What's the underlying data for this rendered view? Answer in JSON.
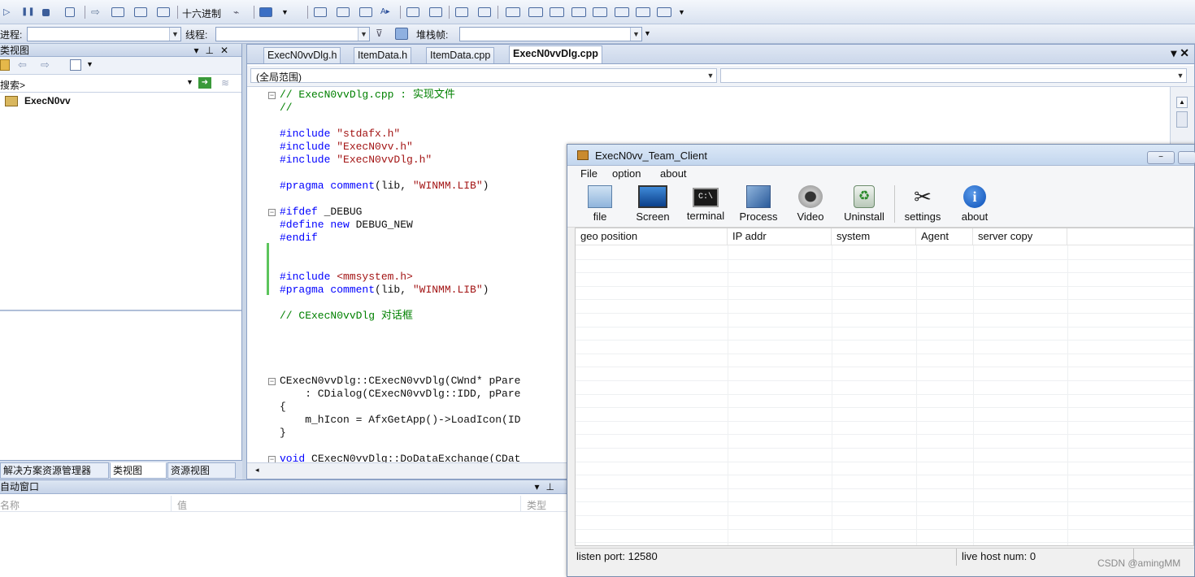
{
  "toolbar": {
    "hex_label": "十六进制",
    "process_label": "进程:",
    "thread_label": "线程:",
    "stackframe_label": "堆栈帧:"
  },
  "classview": {
    "title": "类视图",
    "search_placeholder": "搜索>",
    "tree_root": "ExecN0vv",
    "tabs": [
      "解决方案资源管理器",
      "类视图",
      "资源视图"
    ]
  },
  "editor": {
    "tabs": [
      "ExecN0vvDlg.h",
      "ItemData.h",
      "ItemData.cpp",
      "ExecN0vvDlg.cpp"
    ],
    "active_tab": "ExecN0vvDlg.cpp",
    "close_glyph": "▾ ✕",
    "scope": "(全局范围)",
    "code": {
      "l1": "// ExecN0vvDlg.cpp : 实现文件",
      "l2": "//",
      "l3a": "#include ",
      "l3b": "\"stdafx.h\"",
      "l4a": "#include ",
      "l4b": "\"ExecN0vv.h\"",
      "l5a": "#include ",
      "l5b": "\"ExecN0vvDlg.h\"",
      "l6a": "#pragma comment",
      "l6b": "(lib, ",
      "l6c": "\"WINMM.LIB\"",
      "l6d": ")",
      "l7a": "#ifdef",
      "l7b": " _DEBUG",
      "l8a": "#define",
      "l8b": " new",
      "l8c": " DEBUG_NEW",
      "l9": "#endif",
      "l10a": "#include ",
      "l10b": "<mmsystem.h>",
      "l11a": "#pragma comment",
      "l11b": "(lib, ",
      "l11c": "\"WINMM.LIB\"",
      "l11d": ")",
      "l12": "// CExecN0vvDlg 对话框",
      "l13": "CExecN0vvDlg::CExecN0vvDlg(CWnd* pPare",
      "l14": "    : CDialog(CExecN0vvDlg::IDD, pPare",
      "l15": "{",
      "l16": "    m_hIcon = AfxGetApp()->LoadIcon(ID",
      "l17": "}",
      "l18a": "void",
      "l18b": " CExecN0vvDlg::DoDataExchange(CDat"
    }
  },
  "autowin": {
    "title": "自动窗口",
    "col_name": "名称",
    "col_value": "值",
    "col_type": "类型"
  },
  "dialog": {
    "title": "ExecN0vv_Team_Client",
    "menu": [
      "File",
      "option",
      "about"
    ],
    "tools": [
      {
        "label": "file",
        "icon": "folder-icon"
      },
      {
        "label": "Screen",
        "icon": "monitor-icon"
      },
      {
        "label": "terminal",
        "icon": "terminal-icon"
      },
      {
        "label": "Process",
        "icon": "process-icon"
      },
      {
        "label": "Video",
        "icon": "webcam-icon"
      },
      {
        "label": "Uninstall",
        "icon": "recycle-icon"
      },
      {
        "label": "settings",
        "icon": "tools-icon"
      },
      {
        "label": "about",
        "icon": "info-icon"
      }
    ],
    "columns": [
      "geo position",
      "IP addr",
      "system",
      "Agent",
      "server copy"
    ],
    "status": {
      "listen_port": "listen port: 12580",
      "live_hosts": "live host num: 0"
    }
  },
  "watermark": "CSDN @amingMM",
  "colors": {
    "comment": "#008000",
    "keyword": "#0000ff",
    "string": "#a31515",
    "title_bar": "#c3d6ee"
  }
}
